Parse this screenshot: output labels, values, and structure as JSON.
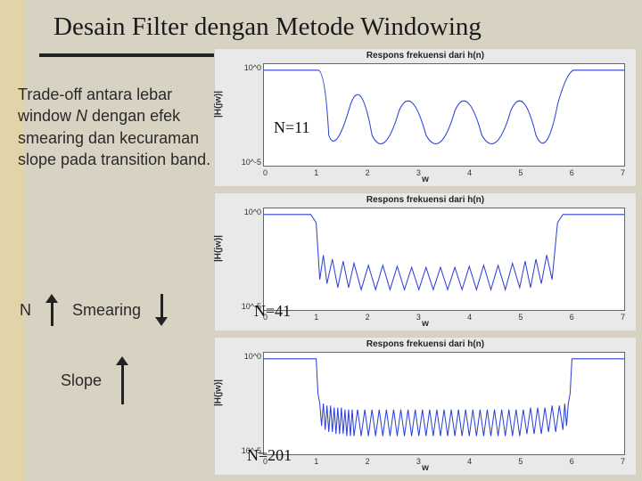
{
  "title": "Desain Filter dengan Metode Windowing",
  "paragraph": {
    "p1": "Trade-off antara lebar window ",
    "nvar": "N",
    "p2": " dengan efek smearing dan kecuraman slope pada transition band."
  },
  "arrows": {
    "n_label": "N",
    "smearing": "Smearing",
    "slope": "Slope"
  },
  "plots": {
    "common": {
      "title": "Respons frekuensi dari h(n)",
      "ylabel": "|H(jw)|",
      "xlabel": "w",
      "xticks": [
        "0",
        "1",
        "2",
        "3",
        "4",
        "5",
        "6",
        "7"
      ],
      "yticks_top": "10^0",
      "yticks_bot": "10^-5"
    },
    "items": [
      {
        "ann": "N=11",
        "ann_class": "n1"
      },
      {
        "ann": "N=41",
        "ann_class": "n2"
      },
      {
        "ann": "N=201",
        "ann_class": "n3"
      }
    ]
  },
  "chart_data": [
    {
      "type": "line",
      "title": "Respons frekuensi dari h(n)",
      "xlabel": "w",
      "ylabel": "|H(jw)|",
      "yscale": "log",
      "xlim": [
        0,
        7
      ],
      "ylim": [
        1e-05,
        1.0
      ],
      "series": [
        {
          "name": "N=11",
          "x": [
            0.0,
            0.5,
            0.9,
            1.35,
            1.9,
            2.45,
            3.0,
            3.6,
            4.2,
            4.8,
            5.4,
            5.9,
            6.3,
            6.8,
            7.0
          ],
          "values": [
            1.0,
            1.0,
            1.0,
            0.001,
            0.1,
            0.001,
            0.05,
            0.001,
            0.05,
            0.001,
            0.1,
            0.001,
            1.0,
            1.0,
            1.0
          ]
        }
      ]
    },
    {
      "type": "line",
      "title": "Respons frekuensi dari h(n)",
      "xlabel": "w",
      "ylabel": "|H(jw)|",
      "yscale": "log",
      "xlim": [
        0,
        7
      ],
      "ylim": [
        1e-05,
        1.0
      ],
      "series": [
        {
          "name": "N=41",
          "x": [
            0.0,
            0.8,
            1.0,
            1.1,
            1.25,
            1.4,
            1.6,
            1.8,
            2.2,
            2.6,
            3.0,
            3.4,
            3.8,
            4.2,
            4.6,
            5.0,
            5.4,
            5.7,
            5.9,
            6.05,
            6.2,
            6.3,
            7.0
          ],
          "values": [
            1.0,
            1.0,
            0.5,
            0.001,
            0.05,
            0.001,
            0.03,
            0.001,
            0.02,
            0.001,
            0.015,
            0.001,
            0.02,
            0.001,
            0.03,
            0.001,
            0.03,
            0.001,
            0.05,
            0.001,
            0.5,
            1.0,
            1.0
          ]
        }
      ]
    },
    {
      "type": "line",
      "title": "Respons frekuensi dari h(n)",
      "xlabel": "w",
      "ylabel": "|H(jw)|",
      "yscale": "log",
      "xlim": [
        0,
        7
      ],
      "ylim": [
        1e-05,
        1.0
      ],
      "series": [
        {
          "name": "N=201",
          "note": "very dense ripples in stopband ~1e-2 to 1e-4; passband ~1.0 for w<1 and w>6.2",
          "x": [
            0.0,
            0.95,
            1.0,
            1.05,
            2.0,
            3.0,
            4.0,
            5.0,
            6.0,
            6.15,
            6.2,
            6.25,
            7.0
          ],
          "values": [
            1.0,
            1.0,
            0.3,
            0.01,
            0.005,
            0.004,
            0.005,
            0.006,
            0.008,
            0.01,
            0.3,
            1.0,
            1.0
          ]
        }
      ]
    }
  ]
}
